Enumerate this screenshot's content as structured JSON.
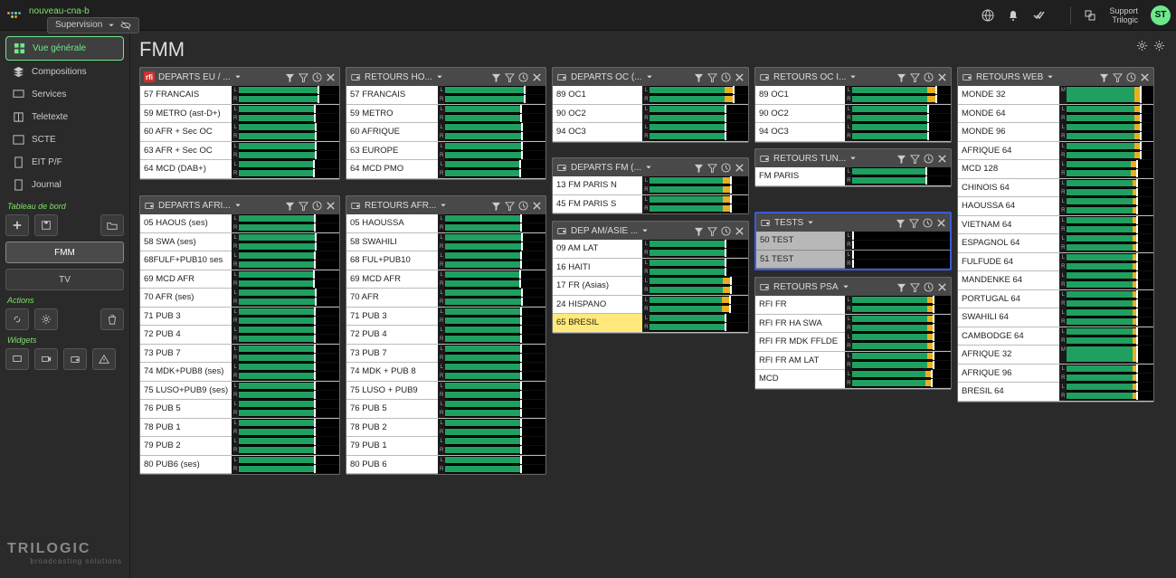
{
  "header": {
    "breadcrumb": "nouveau-cna-b",
    "selector": "Supervision",
    "support_line1": "Support",
    "support_line2": "Trilogic",
    "avatar": "ST"
  },
  "sidebar": {
    "nav": [
      {
        "id": "vue",
        "label": "Vue générale",
        "active": true,
        "icon": "grid"
      },
      {
        "id": "comp",
        "label": "Compositions",
        "icon": "layers"
      },
      {
        "id": "serv",
        "label": "Services",
        "icon": "monitor"
      },
      {
        "id": "tele",
        "label": "Teletexte",
        "icon": "book"
      },
      {
        "id": "scte",
        "label": "SCTE",
        "icon": "window"
      },
      {
        "id": "eit",
        "label": "EIT P/F",
        "icon": "doc"
      },
      {
        "id": "jour",
        "label": "Journal",
        "icon": "page"
      }
    ],
    "section_dashboard": "Tableau de bord",
    "tab_fmm": "FMM",
    "tab_tv": "TV",
    "section_actions": "Actions",
    "section_widgets": "Widgets"
  },
  "brand": {
    "name": "TRILOGIC",
    "tag": "broadcasting solutions"
  },
  "page": {
    "title": "FMM"
  },
  "cards": {
    "deu": {
      "title": "DEPARTS EU / ...",
      "icon": "red",
      "rows": [
        {
          "l": "57 FRANCAIS",
          "g": 78,
          "y": 0
        },
        {
          "l": "59 METRO (ast-D+)",
          "g": 75,
          "y": 0
        },
        {
          "l": "60 AFR + Sec OC",
          "g": 76,
          "y": 0
        },
        {
          "l": "63 AFR + Sec OC",
          "g": 76,
          "y": 0
        },
        {
          "l": "64 MCD (DAB+)",
          "g": 74,
          "y": 0
        }
      ]
    },
    "rho": {
      "title": "RETOURS HO...",
      "icon": "radio",
      "rows": [
        {
          "l": "57 FRANCAIS",
          "g": 78,
          "y": 0
        },
        {
          "l": "59 METRO",
          "g": 75,
          "y": 0
        },
        {
          "l": "60 AFRIQUE",
          "g": 76,
          "y": 0
        },
        {
          "l": "63 EUROPE",
          "g": 76,
          "y": 0
        },
        {
          "l": "64 MCD PMO",
          "g": 74,
          "y": 0
        }
      ]
    },
    "doc": {
      "title": "DEPARTS OC (...",
      "icon": "radio",
      "rows": [
        {
          "l": "89 OC1",
          "g": 76,
          "y": 8
        },
        {
          "l": "90 OC2",
          "g": 76,
          "y": 0
        },
        {
          "l": "94 OC3",
          "g": 76,
          "y": 0
        }
      ]
    },
    "roc": {
      "title": "RETOURS OC I...",
      "icon": "radio",
      "rows": [
        {
          "l": "89 OC1",
          "g": 76,
          "y": 8
        },
        {
          "l": "90 OC2",
          "g": 76,
          "y": 0
        },
        {
          "l": "94 OC3",
          "g": 76,
          "y": 0
        }
      ]
    },
    "rtu": {
      "title": "RETOURS TUN...",
      "icon": "radio",
      "rows": [
        {
          "l": "FM PARIS",
          "g": 74,
          "y": 0
        }
      ]
    },
    "dfm": {
      "title": "DEPARTS FM (...",
      "icon": "radio",
      "rows": [
        {
          "l": "13 FM PARIS N",
          "g": 74,
          "y": 8
        },
        {
          "l": "45 FM PARIS S",
          "g": 74,
          "y": 8
        }
      ]
    },
    "tes": {
      "title": "TESTS",
      "icon": "radio",
      "rows": [
        {
          "l": "50 TEST",
          "g": 0,
          "y": 0
        },
        {
          "l": "51 TEST",
          "g": 0,
          "y": 0
        }
      ]
    },
    "daf": {
      "title": "DEPARTS AFRI...",
      "icon": "radio",
      "rows": [
        {
          "l": "05 HAOUS (ses)",
          "g": 75,
          "y": 0
        },
        {
          "l": "58 SWA (ses)",
          "g": 76,
          "y": 0
        },
        {
          "l": "68FULF+PUB10 ses",
          "g": 75,
          "y": 0
        },
        {
          "l": "69 MCD AFR",
          "g": 74,
          "y": 0
        },
        {
          "l": "70 AFR (ses)",
          "g": 76,
          "y": 0
        },
        {
          "l": "71 PUB 3",
          "g": 75,
          "y": 0
        },
        {
          "l": "72 PUB 4",
          "g": 75,
          "y": 0
        },
        {
          "l": "73 PUB 7",
          "g": 75,
          "y": 0
        },
        {
          "l": "74 MDK+PUB8 (ses)",
          "g": 75,
          "y": 0
        },
        {
          "l": "75 LUSO+PUB9 (ses)",
          "g": 75,
          "y": 0
        },
        {
          "l": "76 PUB 5",
          "g": 75,
          "y": 0
        },
        {
          "l": "78 PUB 1",
          "g": 75,
          "y": 0
        },
        {
          "l": "79 PUB 2",
          "g": 75,
          "y": 0
        },
        {
          "l": "80 PUB6 (ses)",
          "g": 75,
          "y": 0
        }
      ]
    },
    "raf": {
      "title": "RETOURS AFR...",
      "icon": "radio",
      "rows": [
        {
          "l": "05 HAOUSSA",
          "g": 75,
          "y": 0
        },
        {
          "l": "58 SWAHILI",
          "g": 76,
          "y": 0
        },
        {
          "l": "68 FUL+PUB10",
          "g": 75,
          "y": 0
        },
        {
          "l": "69 MCD AFR",
          "g": 74,
          "y": 0
        },
        {
          "l": "70 AFR",
          "g": 76,
          "y": 0
        },
        {
          "l": "71 PUB 3",
          "g": 75,
          "y": 0
        },
        {
          "l": "72 PUB 4",
          "g": 75,
          "y": 0
        },
        {
          "l": "73 PUB 7",
          "g": 75,
          "y": 0
        },
        {
          "l": "74 MDK + PUB 8",
          "g": 75,
          "y": 0
        },
        {
          "l": "75 LUSO + PUB9",
          "g": 75,
          "y": 0
        },
        {
          "l": "76 PUB 5",
          "g": 75,
          "y": 0
        },
        {
          "l": "78 PUB 2",
          "g": 75,
          "y": 0
        },
        {
          "l": "79 PUB 1",
          "g": 75,
          "y": 0
        },
        {
          "l": "80 PUB 6",
          "g": 75,
          "y": 0
        }
      ]
    },
    "dam": {
      "title": "DEP AM/ASIE ...",
      "icon": "radio",
      "rows": [
        {
          "l": "09 AM LAT",
          "g": 76,
          "y": 0
        },
        {
          "l": "16 HAITI",
          "g": 76,
          "y": 0
        },
        {
          "l": "17 FR (Asias)",
          "g": 74,
          "y": 8
        },
        {
          "l": "24 HISPANO",
          "g": 73,
          "y": 8
        },
        {
          "l": "65 BRESIL",
          "g": 76,
          "y": 0,
          "hl": true
        }
      ]
    },
    "psa": {
      "title": "RETOURS PSA",
      "icon": "radio",
      "rows": [
        {
          "l": "RFI FR",
          "g": 76,
          "y": 6
        },
        {
          "l": "RFI FR HA SWA",
          "g": 76,
          "y": 6
        },
        {
          "l": "RFI FR MDK FFLDE",
          "g": 76,
          "y": 6
        },
        {
          "l": "RFI FR AM LAT",
          "g": 76,
          "y": 6
        },
        {
          "l": "MCD",
          "g": 74,
          "y": 6
        }
      ]
    },
    "web": {
      "title": "RETOURS WEB",
      "icon": "radio",
      "rows": [
        {
          "l": "MONDE 32",
          "g": 78,
          "y": 6,
          "m": true
        },
        {
          "l": "MONDE 64",
          "g": 78,
          "y": 6
        },
        {
          "l": "MONDE 96",
          "g": 78,
          "y": 6
        },
        {
          "l": "AFRIQUE 64",
          "g": 78,
          "y": 6
        },
        {
          "l": "MCD 128",
          "g": 74,
          "y": 6
        },
        {
          "l": "CHINOIS 64",
          "g": 76,
          "y": 4
        },
        {
          "l": "HAOUSSA 64",
          "g": 76,
          "y": 4
        },
        {
          "l": "VIETNAM 64",
          "g": 76,
          "y": 4
        },
        {
          "l": "ESPAGNOL 64",
          "g": 76,
          "y": 4
        },
        {
          "l": "FULFUDE 64",
          "g": 76,
          "y": 4
        },
        {
          "l": "MANDENKE 64",
          "g": 76,
          "y": 4
        },
        {
          "l": "PORTUGAL 64",
          "g": 76,
          "y": 4
        },
        {
          "l": "SWAHILI 64",
          "g": 76,
          "y": 4
        },
        {
          "l": "CAMBODGE 64",
          "g": 76,
          "y": 4
        },
        {
          "l": "AFRIQUE 32",
          "g": 76,
          "y": 4,
          "m": true
        },
        {
          "l": "AFRIQUE 96",
          "g": 76,
          "y": 4
        },
        {
          "l": "BRESIL 64",
          "g": 76,
          "y": 4
        }
      ]
    }
  }
}
